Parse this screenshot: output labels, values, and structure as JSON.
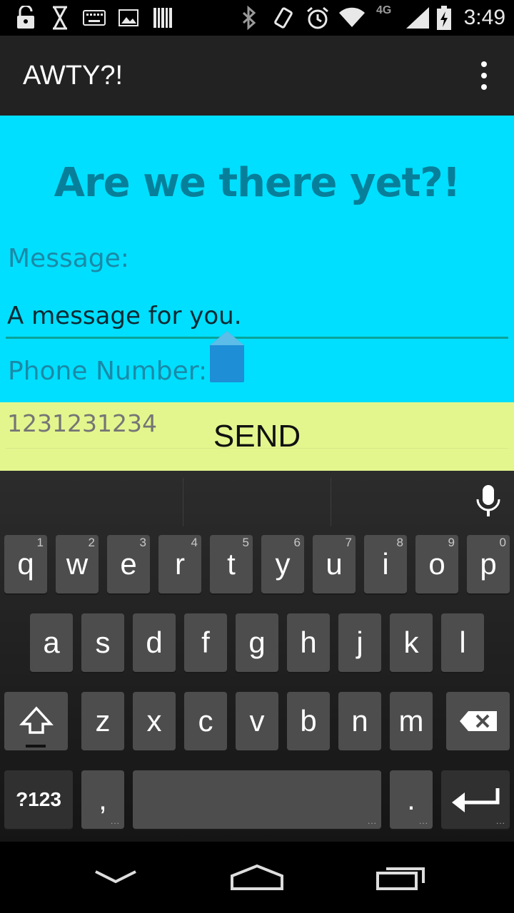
{
  "status_bar": {
    "time": "3:49",
    "network": "4G",
    "icons": [
      "unlock-icon",
      "hourglass-icon",
      "keyboard-icon",
      "image-icon",
      "barcode-icon",
      "bluetooth-icon",
      "vibrate-icon",
      "alarm-icon",
      "wifi-icon",
      "signal-icon",
      "battery-charging-icon"
    ]
  },
  "action_bar": {
    "title": "AWTY?!",
    "overflow_icon": "overflow-menu-icon"
  },
  "main": {
    "headline": "Are we there yet?!",
    "message_label": "Message:",
    "message_value": "A message for you.",
    "phone_label": "Phone Number:",
    "phone_placeholder": "1231231234",
    "send_label": "SEND"
  },
  "colors": {
    "content_bg": "#00dfff",
    "headline": "#087f9a",
    "send_bg": "#e3f68e",
    "action_bar": "#222222"
  },
  "keyboard": {
    "row1": [
      {
        "k": "q",
        "h": "1"
      },
      {
        "k": "w",
        "h": "2"
      },
      {
        "k": "e",
        "h": "3"
      },
      {
        "k": "r",
        "h": "4"
      },
      {
        "k": "t",
        "h": "5"
      },
      {
        "k": "y",
        "h": "6"
      },
      {
        "k": "u",
        "h": "7"
      },
      {
        "k": "i",
        "h": "8"
      },
      {
        "k": "o",
        "h": "9"
      },
      {
        "k": "p",
        "h": "0"
      }
    ],
    "row2": [
      "a",
      "s",
      "d",
      "f",
      "g",
      "h",
      "j",
      "k",
      "l"
    ],
    "row3": [
      "z",
      "x",
      "c",
      "v",
      "b",
      "n",
      "m"
    ],
    "symbols_label": "?123",
    "comma": ",",
    "period": ".",
    "mic_icon": "microphone-icon"
  },
  "nav_bar": {
    "icons": [
      "back-icon",
      "home-icon",
      "recents-icon"
    ]
  }
}
